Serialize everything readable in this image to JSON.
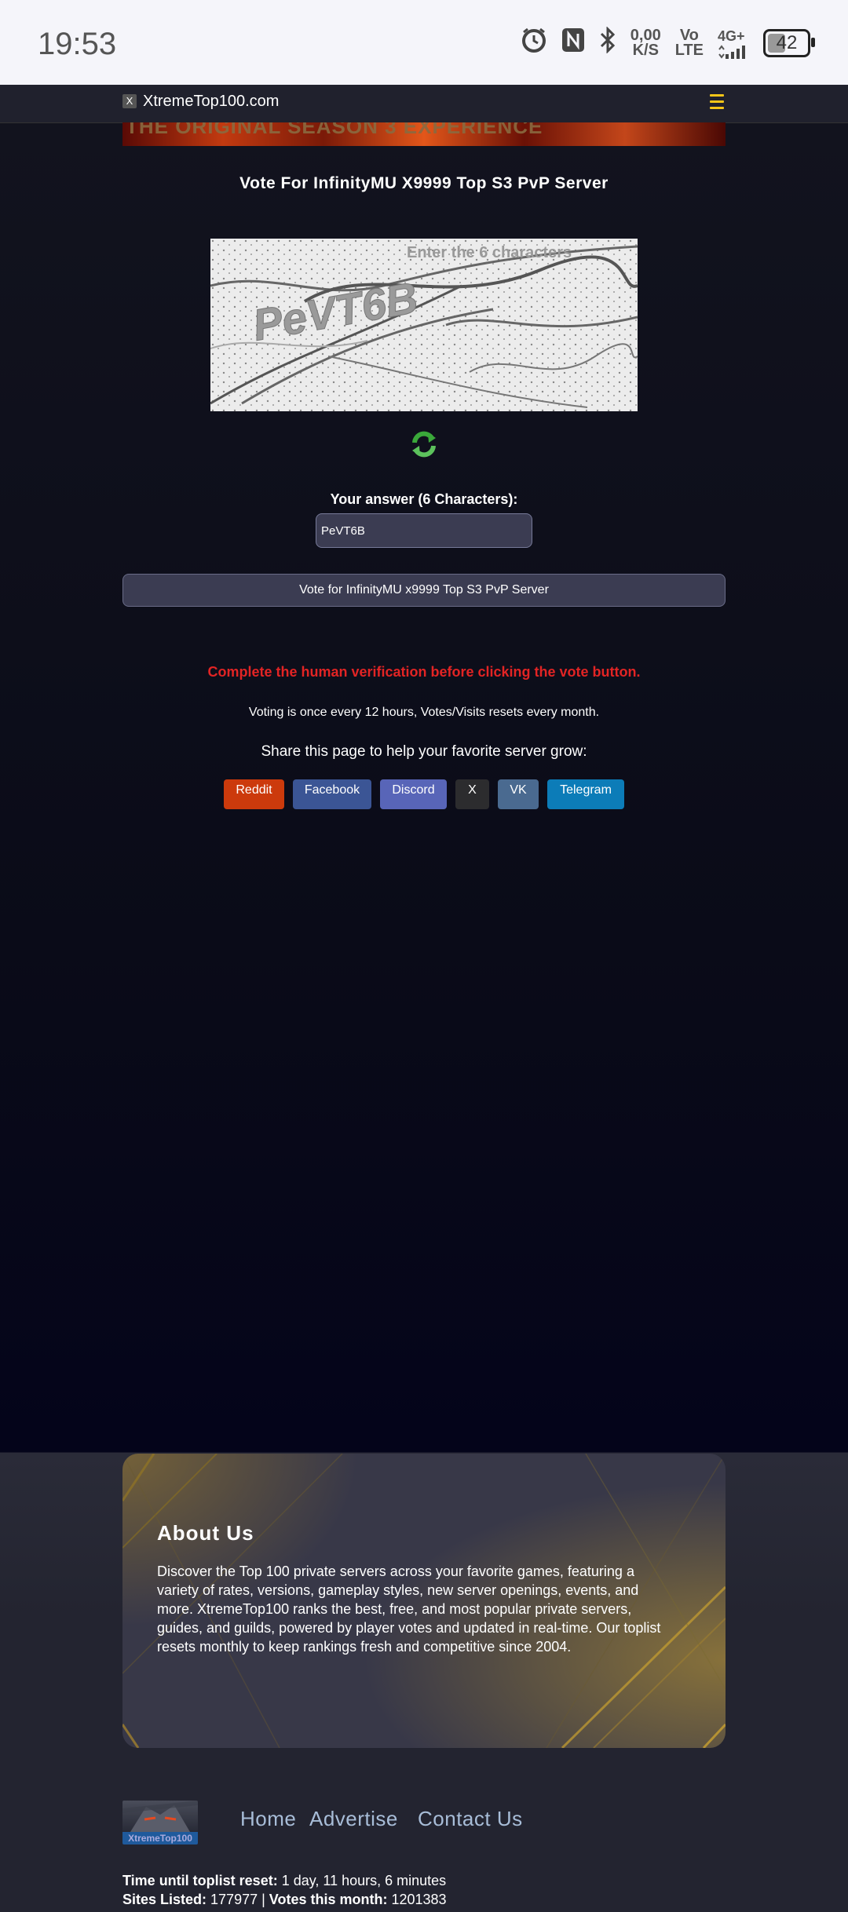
{
  "status_bar": {
    "time": "19:53",
    "net_speed_value": "0,00",
    "net_speed_unit": "K/S",
    "volte_top": "Vo",
    "volte_bottom": "LTE",
    "network": "4G+",
    "battery": "42"
  },
  "navbar": {
    "logo_letter": "X",
    "site_name": "XtremeTop100.com",
    "menu_icon": "hamburger-menu-icon",
    "menu_color": "#f5c518"
  },
  "banner": {
    "text": "THE ORIGINAL SEASON 3 EXPERIENCE"
  },
  "vote": {
    "title": "Vote For InfinityMU X9999 Top S3 PvP Server",
    "captcha_hint": "Enter the 6 characters",
    "captcha_text": "PeVT6B",
    "refresh_icon": "refresh-icon",
    "answer_label": "Your answer (6 Characters):",
    "answer_value": "PeVT6B",
    "button_label": "Vote for InfinityMU x9999 Top S3 PvP Server",
    "error": "Complete the human verification before clicking the vote button.",
    "info": "Voting is once every 12 hours, Votes/Visits resets every month.",
    "share_label": "Share this page to help your favorite server grow:"
  },
  "share_buttons": [
    {
      "label": "Reddit",
      "color": "#cc3a0c"
    },
    {
      "label": "Facebook",
      "color": "#3b5595"
    },
    {
      "label": "Discord",
      "color": "#5865b8"
    },
    {
      "label": "X",
      "color": "#2c2c2e"
    },
    {
      "label": "VK",
      "color": "#4a6a90"
    },
    {
      "label": "Telegram",
      "color": "#0c7cb8"
    }
  ],
  "about": {
    "title": "About Us",
    "text": "Discover the Top 100 private servers across your favorite games, featuring a variety of rates, versions, gameplay styles, new server openings, events, and more. XtremeTop100 ranks the best, free, and most popular private servers, guides, and guilds, powered by player votes and updated in real-time. Our toplist resets monthly to keep rankings fresh and competitive since 2004."
  },
  "footer": {
    "logo_text": "XtremeTop100",
    "nav": [
      "Home",
      "Advertise",
      "Contact Us"
    ],
    "reset_label": "Time until toplist reset:",
    "reset_value": " 1 day, 11 hours, 6 minutes",
    "sites_label": "Sites Listed:",
    "sites_value": " 177977 | ",
    "votes_label": "Votes this month:",
    "votes_value": " 1201383"
  }
}
